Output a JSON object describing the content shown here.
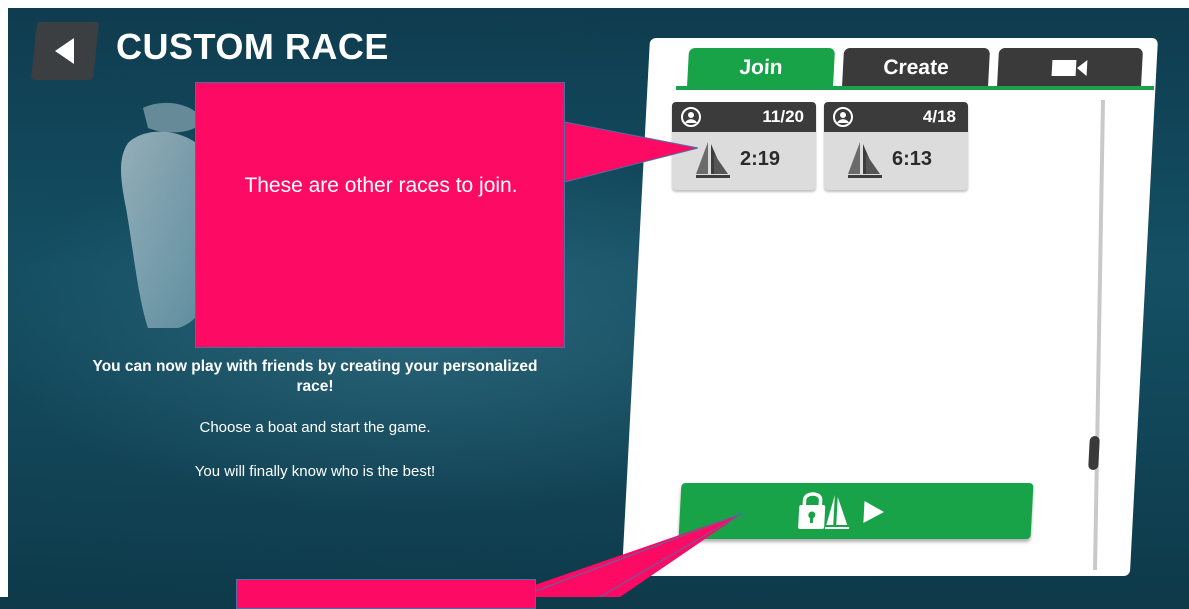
{
  "header": {
    "title": "CUSTOM RACE",
    "back_icon": "back-arrow-icon"
  },
  "info": {
    "line_1": "You can now play with friends by creating your personalized race!",
    "line_2": "Choose a boat and start the game.",
    "line_3": "You will finally know who is the best!"
  },
  "callouts": {
    "races_note": "These are other races to join.",
    "button_note": ""
  },
  "tabs": [
    {
      "label": "Join",
      "active": true
    },
    {
      "label": "Create",
      "active": false
    },
    {
      "label": "",
      "icon": "video-camera-icon",
      "active": false
    }
  ],
  "races": [
    {
      "players": "11/20",
      "time": "2:19",
      "players_icon": "players-icon",
      "boat_icon": "sailboat-icon"
    },
    {
      "players": "4/18",
      "time": "6:13",
      "players_icon": "players-icon",
      "boat_icon": "sailboat-icon"
    }
  ],
  "action_button": {
    "icons": [
      "lock-icon",
      "sailboat-icon",
      "play-icon"
    ]
  },
  "colors": {
    "accent_green": "#18a348",
    "callout_pink": "#fd0a64",
    "dark_tab": "#3a3a3a",
    "background": "#0f3a4a"
  }
}
